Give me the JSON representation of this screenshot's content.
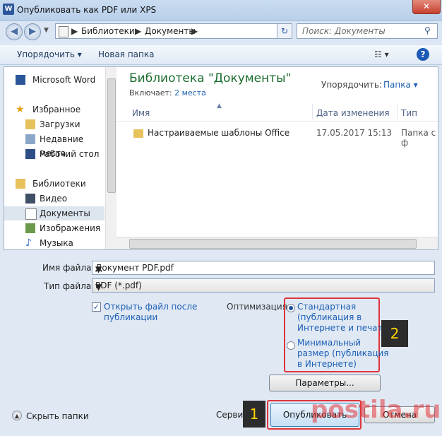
{
  "window": {
    "title": "Опубликовать как PDF или XPS",
    "close_label": "✕",
    "app_icon_letter": "W"
  },
  "nav": {
    "address_parts": [
      "Библиотеки",
      "Документы"
    ],
    "search_placeholder": "Поиск: Документы"
  },
  "toolbar": {
    "organize_label": "Упорядочить ▾",
    "new_folder_label": "Новая папка",
    "help_label": "?"
  },
  "sidebar": {
    "items": [
      {
        "label": "Microsoft Word",
        "icon": "word-icon"
      },
      {
        "label": "Избранное",
        "icon": "star-icon"
      },
      {
        "label": "Загрузки",
        "icon": "folder-download-icon"
      },
      {
        "label": "Недавние места",
        "icon": "recent-places-icon"
      },
      {
        "label": "Рабочий стол",
        "icon": "desktop-icon"
      },
      {
        "label": "Библиотеки",
        "icon": "library-icon"
      },
      {
        "label": "Видео",
        "icon": "video-icon"
      },
      {
        "label": "Документы",
        "icon": "documents-icon"
      },
      {
        "label": "Изображения",
        "icon": "pictures-icon"
      },
      {
        "label": "Музыка",
        "icon": "music-icon"
      }
    ]
  },
  "main": {
    "library_title": "Библиотека \"Документы\"",
    "includes_label": "Включает:",
    "includes_link": "2 места",
    "arrange_label": "Упорядочить:",
    "arrange_value": "Папка ▾",
    "columns": [
      "Имя",
      "Дата изменения",
      "Тип"
    ],
    "rows": [
      {
        "name": "Настраиваемые шаблоны Office",
        "date": "17.05.2017 15:13",
        "type": "Папка с ф"
      }
    ]
  },
  "form": {
    "filename_label": "Имя файла:",
    "filename_value": "Документ PDF.pdf",
    "filetype_label": "Тип файла:",
    "filetype_value": "PDF (*.pdf)",
    "open_after_line1": "Открыть файл после",
    "open_after_line2": "публикации",
    "optimization_label": "Оптимизация:",
    "opt_standard_1": "Стандартная",
    "opt_standard_2": "(публикация в",
    "opt_standard_3": "Интернете и печать)",
    "opt_min_1": "Минимальный",
    "opt_min_2": "размер (публикация",
    "opt_min_3": "в Интернете)",
    "params_button": "Параметры...",
    "hide_folders": "Скрыть папки",
    "service_label": "Сервис",
    "publish_button": "Опубликовать",
    "cancel_button": "Отмена"
  },
  "annotations": {
    "badge_1": "1",
    "badge_2": "2"
  },
  "watermark": "postila.ru",
  "colors": {
    "accent_red": "#e0353b",
    "library_green": "#1a6d2f",
    "link_blue": "#1c5fb5"
  }
}
